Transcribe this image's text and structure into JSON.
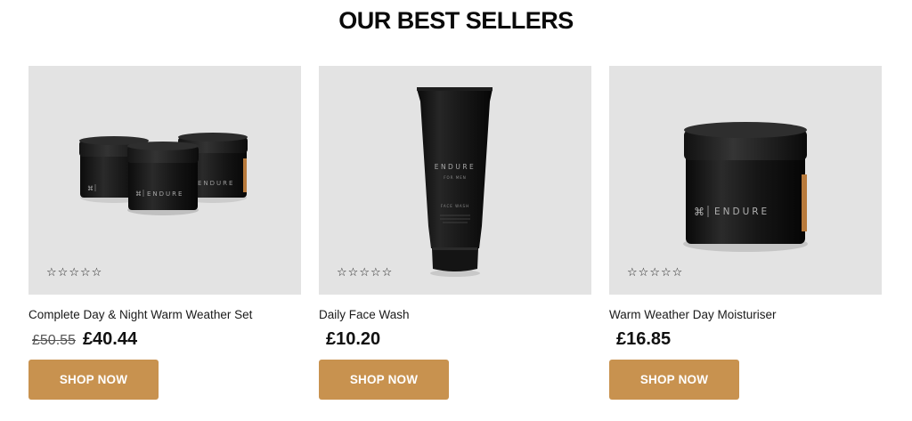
{
  "section": {
    "title": "OUR BEST SELLERS"
  },
  "brand": {
    "logo_text": "ENDURE"
  },
  "products": [
    {
      "name": "Complete Day & Night Warm Weather Set",
      "old_price": "£50.55",
      "price": "£40.44",
      "rating_stars": 0,
      "button_label": "SHOP NOW",
      "image_icon": "three-jars-image"
    },
    {
      "name": "Daily Face Wash",
      "old_price": "",
      "price": "£10.20",
      "rating_stars": 0,
      "button_label": "SHOP NOW",
      "image_icon": "face-wash-tube-image",
      "tube_lines": [
        "FOR MEN",
        "FACE WASH"
      ]
    },
    {
      "name": "Warm Weather Day Moisturiser",
      "old_price": "",
      "price": "£16.85",
      "rating_stars": 0,
      "button_label": "SHOP NOW",
      "image_icon": "moisturiser-jar-image"
    }
  ],
  "colors": {
    "button_bg": "#c8924f",
    "image_bg": "#e3e3e3",
    "product_black": "#121212",
    "accent_orange": "#b87a3c"
  }
}
